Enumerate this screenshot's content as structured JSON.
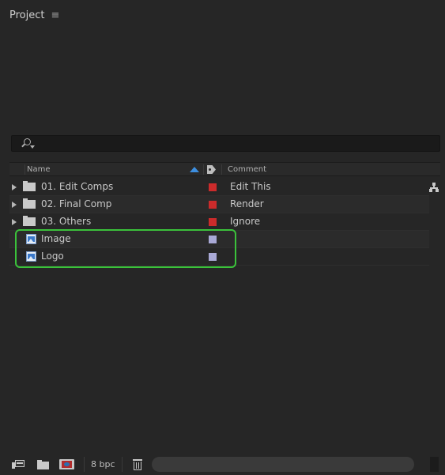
{
  "panel": {
    "title": "Project",
    "menu_glyph": "≡"
  },
  "search": {
    "value": "",
    "placeholder": ""
  },
  "columns": {
    "name": "Name",
    "comment": "Comment"
  },
  "items": [
    {
      "type": "folder",
      "name": "01. Edit Comps",
      "label_color": "#cc2b2b",
      "comment": "Edit This"
    },
    {
      "type": "folder",
      "name": "02. Final Comp",
      "label_color": "#cc2b2b",
      "comment": "Render"
    },
    {
      "type": "folder",
      "name": "03. Others",
      "label_color": "#cc2b2b",
      "comment": "Ignore"
    },
    {
      "type": "image",
      "name": "Image",
      "label_color": "#a9a9d6",
      "comment": ""
    },
    {
      "type": "image",
      "name": "Logo",
      "label_color": "#a9a9d6",
      "comment": ""
    }
  ],
  "footer": {
    "bit_depth": "8 bpc"
  },
  "colors": {
    "accent": "#3d8fe0",
    "highlight": "#3bc23b"
  }
}
